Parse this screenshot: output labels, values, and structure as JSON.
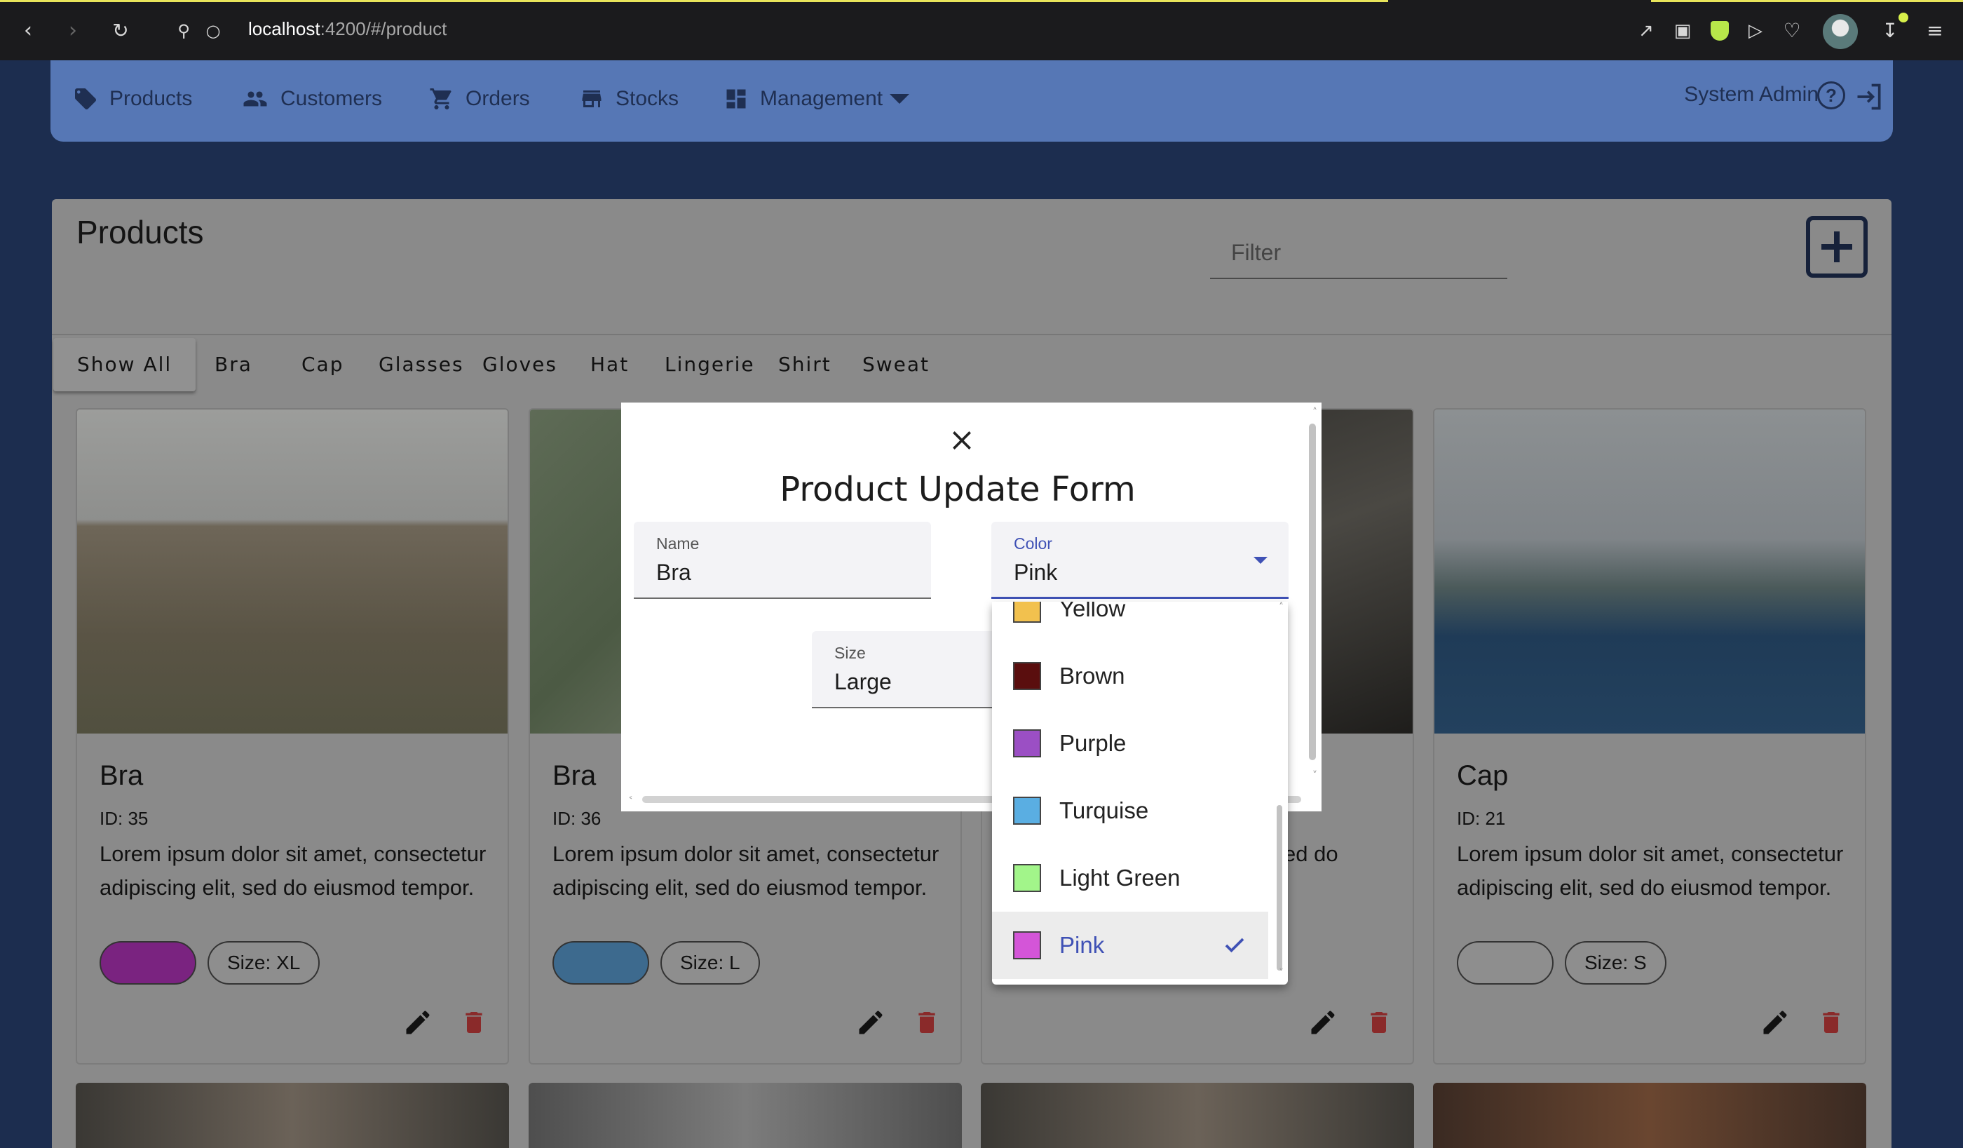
{
  "browser": {
    "url_host": "localhost",
    "url_path": ":4200/#/product"
  },
  "nav": {
    "items": [
      {
        "label": "Products",
        "icon": "tag-icon"
      },
      {
        "label": "Customers",
        "icon": "people-icon"
      },
      {
        "label": "Orders",
        "icon": "cart-icon"
      },
      {
        "label": "Stocks",
        "icon": "store-icon"
      },
      {
        "label": "Management",
        "icon": "dashboard-icon"
      }
    ],
    "user": "System Admin"
  },
  "page": {
    "title": "Products",
    "filter_placeholder": "Filter",
    "categories": [
      "Show All",
      "Bra",
      "Cap",
      "Glasses",
      "Gloves",
      "Hat",
      "Lingerie",
      "Shirt",
      "Sweat"
    ]
  },
  "cards": [
    {
      "title": "Bra",
      "id": "ID: 35",
      "desc": "Lorem ipsum dolor sit amet, consectetur adipiscing elit, sed do eiusmod tempor.",
      "color": "#8a2a8e",
      "size": "Size: XL"
    },
    {
      "title": "Bra",
      "id": "ID: 36",
      "desc": "Lorem ipsum dolor sit amet, consectetur adipiscing elit, sed do eiusmod tempor.",
      "color": "#44739a",
      "size": "Size: L"
    },
    {
      "title": "",
      "id": "",
      "desc": "ed do",
      "color": "",
      "size": ""
    },
    {
      "title": "Cap",
      "id": "ID: 21",
      "desc": "Lorem ipsum dolor sit amet, consectetur adipiscing elit, sed do eiusmod tempor.",
      "color": "#8e8e8e",
      "size": "Size: S"
    }
  ],
  "dialog": {
    "title": "Product Update Form",
    "name_label": "Name",
    "name_value": "Bra",
    "color_label": "Color",
    "color_value": "Pink",
    "size_label": "Size",
    "size_value": "Large"
  },
  "color_options": [
    {
      "label": "Yellow",
      "swatch": "#f2c14e"
    },
    {
      "label": "Brown",
      "swatch": "#5a0e0e"
    },
    {
      "label": "Purple",
      "swatch": "#9b4fc4"
    },
    {
      "label": "Turquise",
      "swatch": "#5aaee2"
    },
    {
      "label": "Light Green",
      "swatch": "#a2f58a"
    },
    {
      "label": "Pink",
      "swatch": "#d455d8",
      "selected": true
    }
  ]
}
